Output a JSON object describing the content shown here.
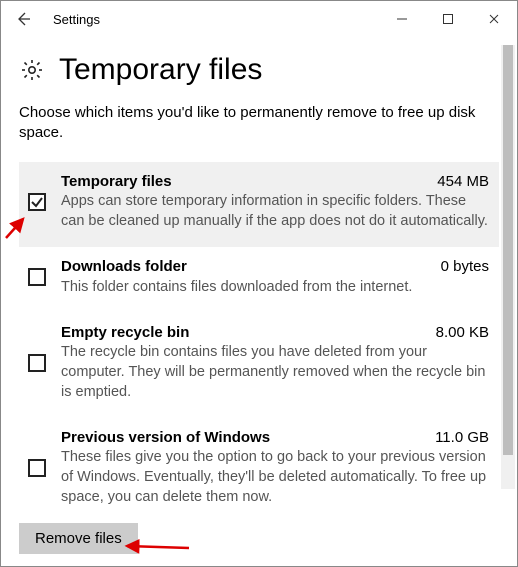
{
  "titlebar": {
    "title": "Settings"
  },
  "header": {
    "title": "Temporary files"
  },
  "description": "Choose which items you'd like to permanently remove to free up disk space.",
  "items": [
    {
      "name": "Temporary files",
      "size": "454 MB",
      "desc": "Apps can store temporary information in specific folders. These can be cleaned up manually if the app does not do it automatically.",
      "checked": true,
      "highlight": true
    },
    {
      "name": "Downloads folder",
      "size": "0 bytes",
      "desc": "This folder contains files downloaded from the internet.",
      "checked": false,
      "highlight": false
    },
    {
      "name": "Empty recycle bin",
      "size": "8.00 KB",
      "desc": "The recycle bin contains files you have deleted from your computer. They will be permanently removed when the recycle bin is emptied.",
      "checked": false,
      "highlight": false
    },
    {
      "name": "Previous version of Windows",
      "size": "11.0 GB",
      "desc": "These files give you the option to go back to your previous version of Windows. Eventually, they'll be deleted automatically. To free up space, you can delete them now.",
      "checked": false,
      "highlight": false
    }
  ],
  "button": {
    "remove": "Remove files"
  }
}
